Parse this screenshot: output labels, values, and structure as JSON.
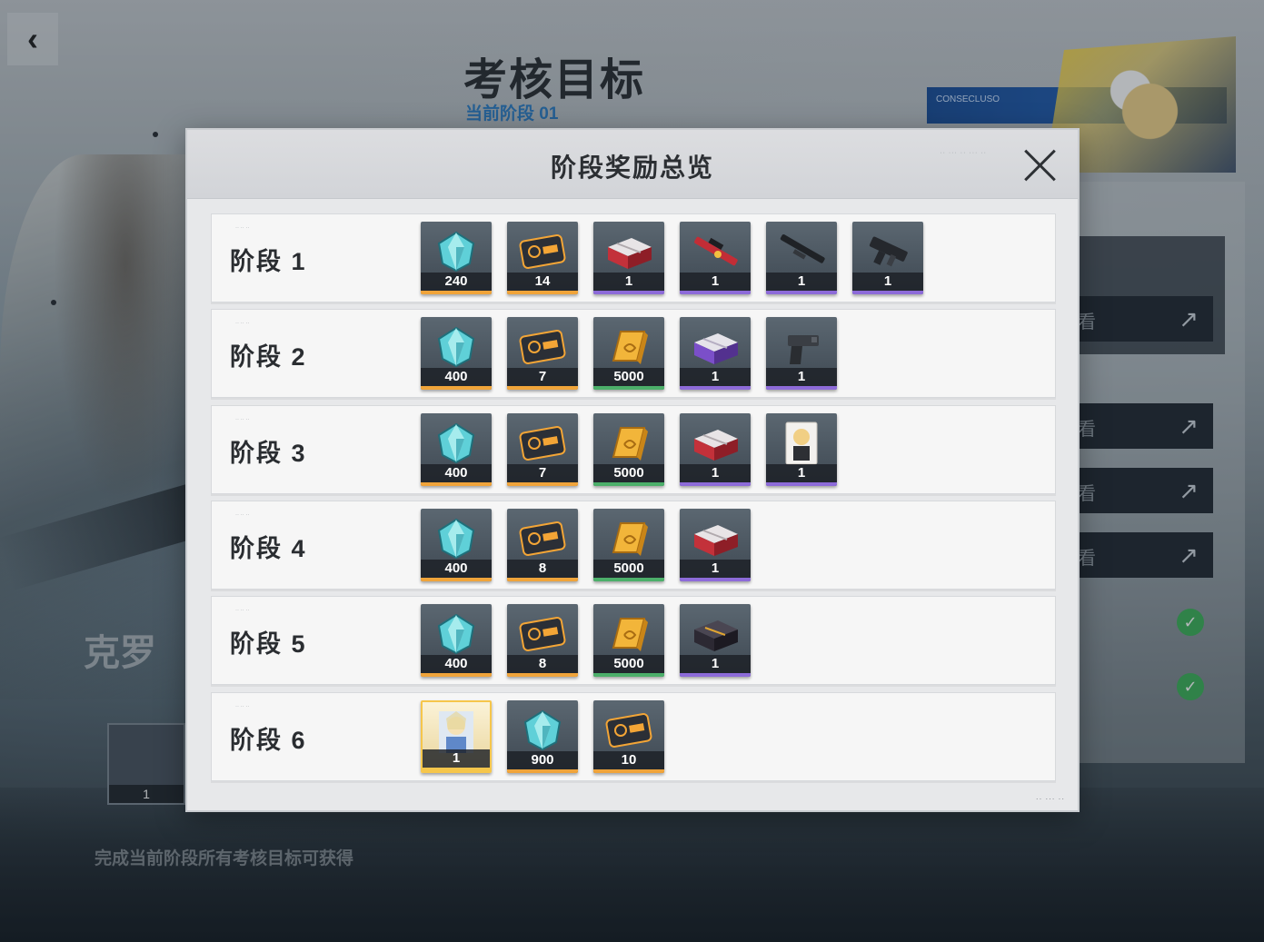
{
  "page": {
    "title": "考核目标",
    "current_stage": "当前阶段 01",
    "banner_text": "CONSECLUSO",
    "character_name": "克罗",
    "bottom_item_count": "1",
    "bottom_hint": "完成当前阶段所有考核目标可获得"
  },
  "modal": {
    "title": "阶段奖励总览",
    "stages": [
      {
        "name": "阶段 1",
        "rewards": [
          {
            "icon": "crystal-icon",
            "count": "240",
            "rarity": "orange"
          },
          {
            "icon": "ticket-icon",
            "count": "14",
            "rarity": "orange"
          },
          {
            "icon": "red-supply-box-icon",
            "count": "1",
            "rarity": "purple"
          },
          {
            "icon": "red-rifle-icon",
            "count": "1",
            "rarity": "purple"
          },
          {
            "icon": "shotgun-icon",
            "count": "1",
            "rarity": "purple"
          },
          {
            "icon": "smg-icon",
            "count": "1",
            "rarity": "purple"
          }
        ]
      },
      {
        "name": "阶段 2",
        "rewards": [
          {
            "icon": "crystal-icon",
            "count": "400",
            "rarity": "orange"
          },
          {
            "icon": "ticket-icon",
            "count": "7",
            "rarity": "orange"
          },
          {
            "icon": "gold-bar-icon",
            "count": "5000",
            "rarity": "green"
          },
          {
            "icon": "purple-supply-box-icon",
            "count": "1",
            "rarity": "purple"
          },
          {
            "icon": "pistol-icon",
            "count": "1",
            "rarity": "purple"
          }
        ]
      },
      {
        "name": "阶段 3",
        "rewards": [
          {
            "icon": "crystal-icon",
            "count": "400",
            "rarity": "orange"
          },
          {
            "icon": "ticket-icon",
            "count": "7",
            "rarity": "orange"
          },
          {
            "icon": "gold-bar-icon",
            "count": "5000",
            "rarity": "green"
          },
          {
            "icon": "red-supply-box-icon",
            "count": "1",
            "rarity": "purple"
          },
          {
            "icon": "character-card-icon",
            "count": "1",
            "rarity": "purple"
          }
        ]
      },
      {
        "name": "阶段 4",
        "rewards": [
          {
            "icon": "crystal-icon",
            "count": "400",
            "rarity": "orange"
          },
          {
            "icon": "ticket-icon",
            "count": "8",
            "rarity": "orange"
          },
          {
            "icon": "gold-bar-icon",
            "count": "5000",
            "rarity": "green"
          },
          {
            "icon": "red-supply-box-icon",
            "count": "1",
            "rarity": "purple"
          }
        ]
      },
      {
        "name": "阶段 5",
        "rewards": [
          {
            "icon": "crystal-icon",
            "count": "400",
            "rarity": "orange"
          },
          {
            "icon": "ticket-icon",
            "count": "8",
            "rarity": "orange"
          },
          {
            "icon": "gold-bar-icon",
            "count": "5000",
            "rarity": "green"
          },
          {
            "icon": "dark-supply-box-icon",
            "count": "1",
            "rarity": "purple"
          }
        ]
      },
      {
        "name": "阶段 6",
        "rewards": [
          {
            "icon": "character-portrait-icon",
            "count": "1",
            "rarity": "gold"
          },
          {
            "icon": "crystal-icon",
            "count": "900",
            "rarity": "orange"
          },
          {
            "icon": "ticket-icon",
            "count": "10",
            "rarity": "orange"
          }
        ]
      }
    ]
  },
  "side_panel": {
    "buttons": [
      {
        "label": "看",
        "icon": "arrow-up-right-icon"
      },
      {
        "label": "看",
        "icon": "arrow-up-right-icon"
      },
      {
        "label": "看",
        "icon": "arrow-up-right-icon"
      },
      {
        "label": "看",
        "icon": "arrow-up-right-icon"
      }
    ],
    "completed_marks": 2
  },
  "colors": {
    "accent_blue": "#2f7fc7",
    "rarity_orange": "#f0a43a",
    "rarity_purple": "#8d6bd9",
    "rarity_green": "#4caf6a",
    "rarity_gold": "#f6c64b",
    "check_green": "#3fb35a"
  }
}
